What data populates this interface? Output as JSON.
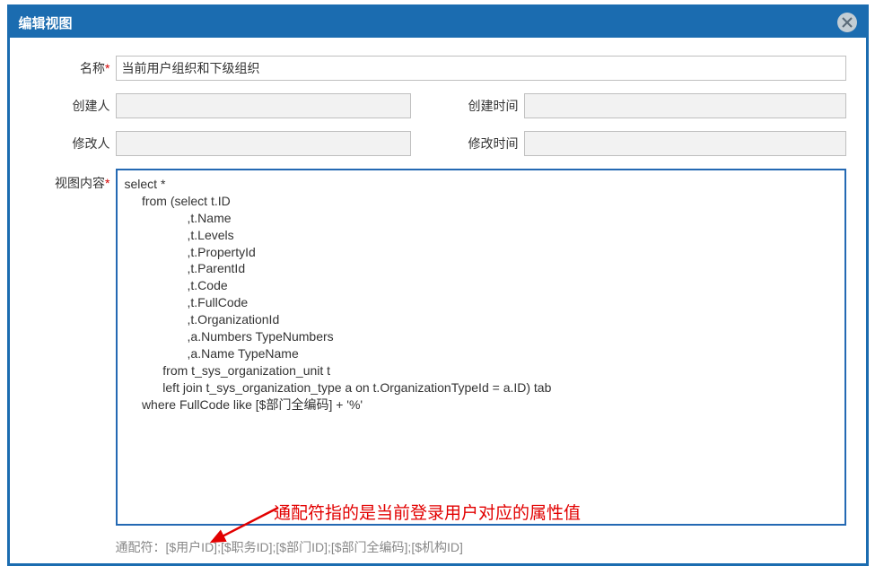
{
  "dialog": {
    "title": "编辑视图"
  },
  "form": {
    "name_label": "名称",
    "name_value": "当前用户组织和下级组织",
    "creator_label": "创建人",
    "creator_value": "",
    "create_time_label": "创建时间",
    "create_time_value": "",
    "modifier_label": "修改人",
    "modifier_value": "",
    "modify_time_label": "修改时间",
    "modify_time_value": "",
    "content_label": "视图内容",
    "content_value": "select *\n     from (select t.ID\n                  ,t.Name\n                  ,t.Levels\n                  ,t.PropertyId\n                  ,t.ParentId\n                  ,t.Code\n                  ,t.FullCode\n                  ,t.OrganizationId\n                  ,a.Numbers TypeNumbers\n                  ,a.Name TypeName\n           from t_sys_organization_unit t\n           left join t_sys_organization_type a on t.OrganizationTypeId = a.ID) tab\n     where FullCode like [$部门全编码] + '%'",
    "wildcard_hint": "通配符：[$用户ID];[$职务ID];[$部门ID];[$部门全编码];[$机构ID]"
  },
  "annotation": {
    "text": "通配符指的是当前登录用户对应的属性值"
  }
}
